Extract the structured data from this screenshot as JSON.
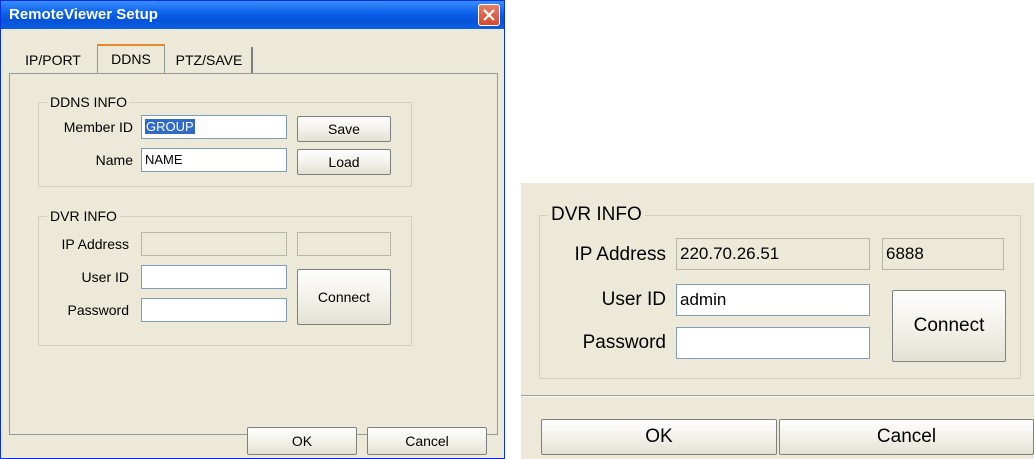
{
  "dialog": {
    "title": "RemoteViewer Setup",
    "close_icon": "close-icon",
    "tabs": [
      {
        "label": "IP/PORT"
      },
      {
        "label": "DDNS"
      },
      {
        "label": "PTZ/SAVE"
      }
    ],
    "ddns_info": {
      "group_label": "DDNS INFO",
      "member_id_label": "Member ID",
      "member_id_value": "GROUP",
      "name_label": "Name",
      "name_value": "NAME",
      "save_label": "Save",
      "load_label": "Load"
    },
    "dvr_info": {
      "group_label": "DVR INFO",
      "ip_label": "IP Address",
      "ip_value": "",
      "port_value": "",
      "user_id_label": "User ID",
      "user_id_value": "",
      "password_label": "Password",
      "password_value": "",
      "connect_label": "Connect"
    },
    "ok_label": "OK",
    "cancel_label": "Cancel"
  },
  "zoomed": {
    "dvr_info": {
      "group_label": "DVR INFO",
      "ip_label": "IP Address",
      "ip_value": "220.70.26.51",
      "port_value": "6888",
      "user_id_label": "User ID",
      "user_id_value": "admin",
      "password_label": "Password",
      "password_value": "",
      "connect_label": "Connect"
    },
    "ok_label": "OK",
    "cancel_label": "Cancel"
  }
}
